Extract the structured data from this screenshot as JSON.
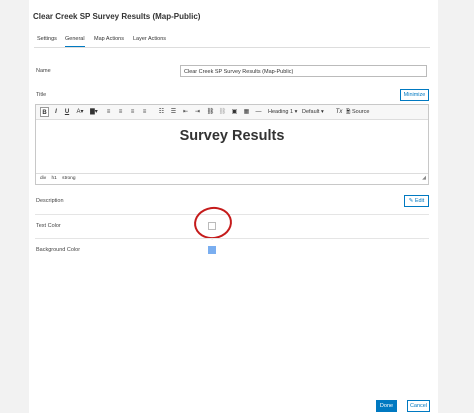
{
  "dialog": {
    "title": "Clear Creek SP Survey Results (Map-Public)",
    "tabs": [
      {
        "label": "Settings"
      },
      {
        "label": "General"
      },
      {
        "label": "Map Actions"
      },
      {
        "label": "Layer Actions"
      }
    ],
    "active_tab": "General"
  },
  "form": {
    "name_label": "Name",
    "name_value": "Clear Creek SP Survey Results (Map-Public)",
    "title_label": "Title",
    "minimize_label": "Minimize",
    "description_label": "Description",
    "edit_label": "Edit",
    "text_color_label": "Text Color",
    "background_color_label": "Background Color",
    "background_color_value": "#7aaef0"
  },
  "editor": {
    "toolbar": {
      "bold": "B",
      "italic": "I",
      "underline": "U",
      "heading": "Heading 1",
      "font": "Default",
      "clear_format": "Tx",
      "source": "Source"
    },
    "content_heading": "Survey Results",
    "status_path": [
      "div",
      "h1",
      "strong"
    ]
  },
  "footer": {
    "done_label": "Done",
    "cancel_label": "Cancel"
  },
  "colors": {
    "accent": "#0079c1",
    "annotation": "#c51b1b"
  }
}
